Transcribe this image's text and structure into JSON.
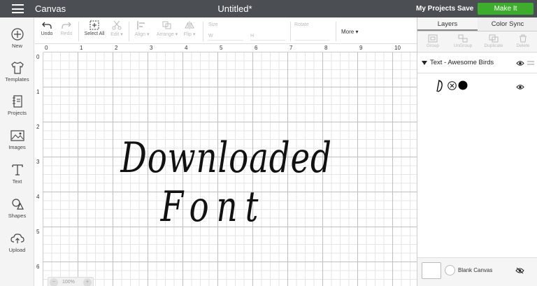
{
  "topbar": {
    "app_title": "Canvas",
    "doc_title": "Untitled*",
    "my_projects": "My Projects",
    "save": "Save",
    "make_it": "Make It",
    "make_it_color": "#3dae2b"
  },
  "sidebar": {
    "items": [
      {
        "label": "New",
        "icon": "plus-circle-icon"
      },
      {
        "label": "Templates",
        "icon": "tshirt-icon"
      },
      {
        "label": "Projects",
        "icon": "notebook-icon"
      },
      {
        "label": "Images",
        "icon": "image-icon"
      },
      {
        "label": "Text",
        "icon": "text-t-icon"
      },
      {
        "label": "Shapes",
        "icon": "shapes-icon"
      },
      {
        "label": "Upload",
        "icon": "cloud-upload-icon"
      }
    ]
  },
  "toolbar": {
    "undo": "Undo",
    "redo": "Redo",
    "select_all": "Select All",
    "edit": "Edit ▾",
    "align": "Align ▾",
    "arrange": "Arrange ▾",
    "flip": "Flip ▾",
    "size_label": "Size",
    "w_label": "W",
    "h_label": "H",
    "rotate_label": "Rotate",
    "more": "More ▾"
  },
  "canvas": {
    "ruler_top": [
      "0",
      "1",
      "2",
      "3",
      "4",
      "5",
      "6",
      "7",
      "8",
      "9",
      "10"
    ],
    "ruler_left": [
      "0",
      "1",
      "2",
      "3",
      "4",
      "5",
      "6"
    ],
    "design_line1": "Downloaded",
    "design_line2": "Font",
    "zoom_value": "100%",
    "zoom_minus": "−",
    "zoom_plus": "+"
  },
  "panel": {
    "tab_layers": "Layers",
    "tab_color_sync": "Color Sync",
    "tools": [
      "Group",
      "UnGroup",
      "Duplicate",
      "Delete"
    ],
    "layer_title": "Text - Awesome Birds",
    "blank_canvas": "Blank Canvas"
  }
}
